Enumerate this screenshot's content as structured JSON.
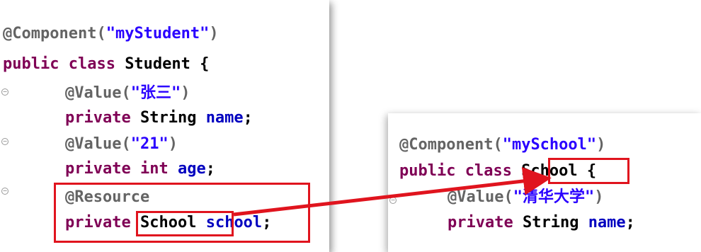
{
  "student_class": {
    "lines": [
      {
        "tokens": [
          {
            "t": "@Component(",
            "c": "anno"
          },
          {
            "t": "\"myStudent\"",
            "c": "str"
          },
          {
            "t": ")",
            "c": "anno"
          }
        ]
      },
      {
        "tokens": [
          {
            "t": "public class ",
            "c": "kw"
          },
          {
            "t": "Student {",
            "c": "plain"
          }
        ]
      },
      {
        "tokens": [
          {
            "t": "@Value(",
            "c": "anno"
          },
          {
            "t": "\"张三\"",
            "c": "str"
          },
          {
            "t": ")",
            "c": "anno"
          }
        ]
      },
      {
        "tokens": [
          {
            "t": "private ",
            "c": "kw"
          },
          {
            "t": "String ",
            "c": "plain"
          },
          {
            "t": "name",
            "c": "fld"
          },
          {
            "t": ";",
            "c": "plain"
          }
        ]
      },
      {
        "tokens": [
          {
            "t": "@Value(",
            "c": "anno"
          },
          {
            "t": "\"21\"",
            "c": "str"
          },
          {
            "t": ")",
            "c": "anno"
          }
        ]
      },
      {
        "tokens": [
          {
            "t": "private int ",
            "c": "kw"
          },
          {
            "t": "age",
            "c": "fld"
          },
          {
            "t": ";",
            "c": "plain"
          }
        ]
      },
      {
        "tokens": [
          {
            "t": "@Resource",
            "c": "anno"
          }
        ]
      },
      {
        "tokens": [
          {
            "t": "private ",
            "c": "kw"
          },
          {
            "t": "School",
            "c": "plain"
          },
          {
            "t": " ",
            "c": "plain"
          },
          {
            "t": "school",
            "c": "fld"
          },
          {
            "t": ";",
            "c": "plain"
          }
        ]
      }
    ]
  },
  "school_class": {
    "lines": [
      {
        "tokens": [
          {
            "t": "@Component(",
            "c": "anno"
          },
          {
            "t": "\"mySchool\"",
            "c": "str"
          },
          {
            "t": ")",
            "c": "anno"
          }
        ]
      },
      {
        "tokens": [
          {
            "t": "public class ",
            "c": "kw"
          },
          {
            "t": "School",
            "c": "plain"
          },
          {
            "t": " {",
            "c": "plain"
          }
        ]
      },
      {
        "tokens": [
          {
            "t": "@Value(",
            "c": "anno"
          },
          {
            "t": "\"清华大学\"",
            "c": "str"
          },
          {
            "t": ")",
            "c": "anno"
          }
        ]
      },
      {
        "tokens": [
          {
            "t": "private ",
            "c": "kw"
          },
          {
            "t": "String ",
            "c": "plain"
          },
          {
            "t": "name",
            "c": "fld"
          },
          {
            "t": ";",
            "c": "plain"
          }
        ]
      }
    ]
  },
  "colors": {
    "annotation": "#646464",
    "keyword": "#7f0055",
    "string": "#2a00ff",
    "field": "#0000c0",
    "highlight": "#e0141e"
  },
  "icons": [
    "fold-marker-icon",
    "arrow-icon"
  ]
}
